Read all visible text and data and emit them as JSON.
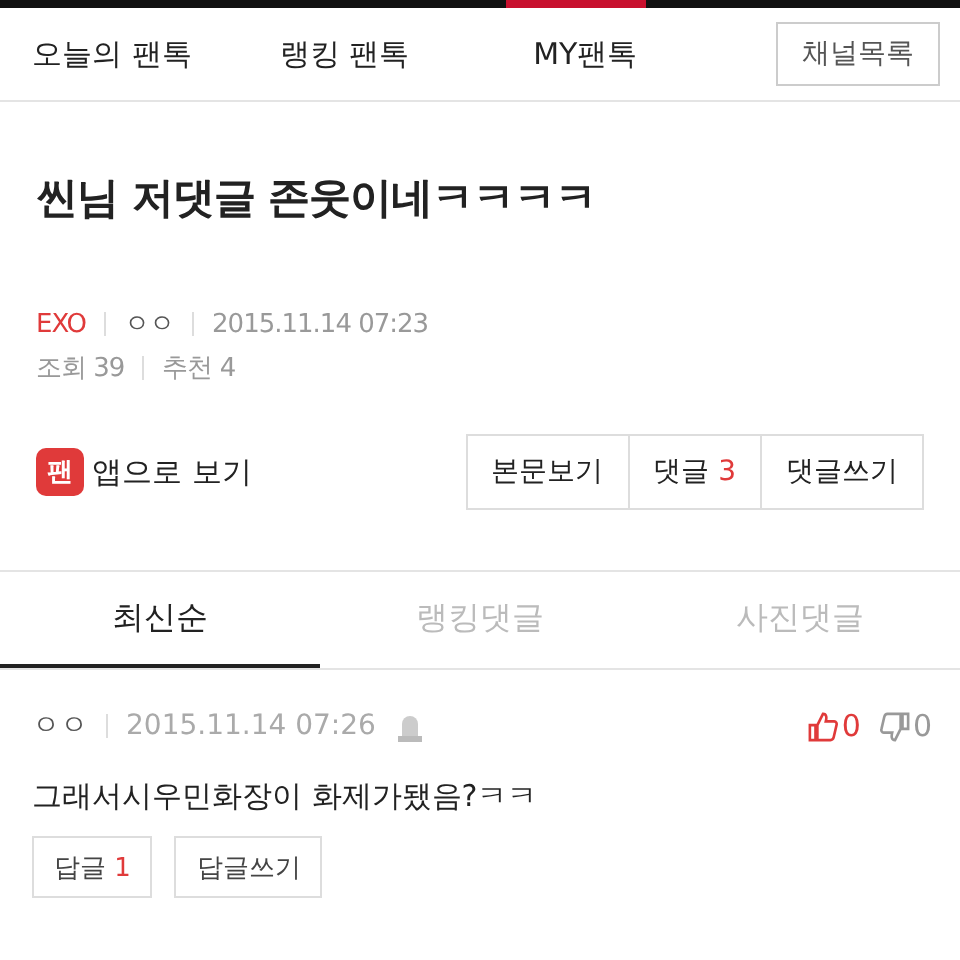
{
  "nav": {
    "items": [
      {
        "label": "오늘의 팬톡"
      },
      {
        "label": "랭킹 팬톡"
      },
      {
        "label": "MY팬톡"
      }
    ],
    "channel_button": "채널목록"
  },
  "post": {
    "title": "씬님 저댓글 존웃이네ㅋㅋㅋㅋ",
    "channel": "EXO",
    "author": "ㅇㅇ",
    "date": "2015.11.14 07:23",
    "views_label": "조회",
    "views": "39",
    "recommend_label": "추천",
    "recommend": "4"
  },
  "app_link": {
    "icon_text": "팬",
    "label": "앱으로 보기"
  },
  "actions": [
    {
      "label": "본문보기"
    },
    {
      "label": "댓글",
      "count": "3"
    },
    {
      "label": "댓글쓰기"
    }
  ],
  "tabs": [
    {
      "label": "최신순",
      "selected": true
    },
    {
      "label": "랭킹댓글",
      "selected": false
    },
    {
      "label": "사진댓글",
      "selected": false
    }
  ],
  "comments": [
    {
      "author": "ㅇㅇ",
      "date": "2015.11.14 07:26",
      "likes": "0",
      "dislikes": "0",
      "text": "그래서시우민화장이 화제가됐음?ㅋㅋ",
      "reply_label": "답글",
      "reply_count": "1",
      "write_reply": "답글쓰기"
    }
  ]
}
